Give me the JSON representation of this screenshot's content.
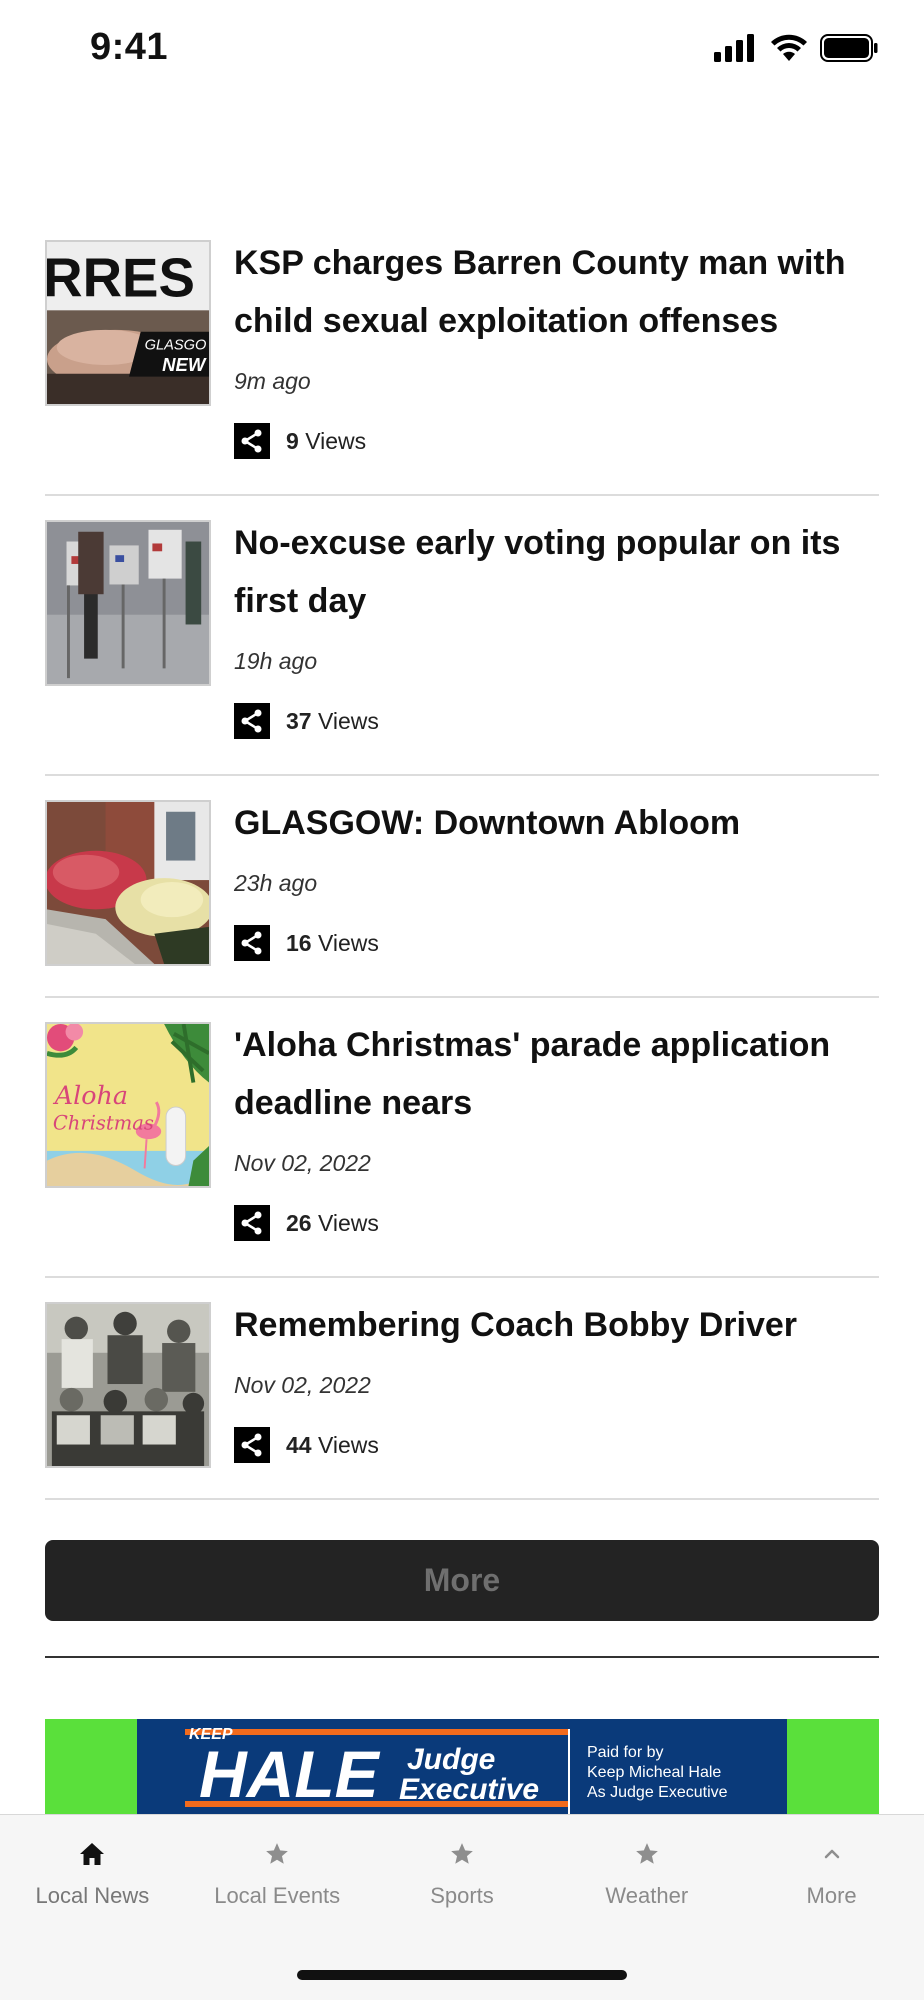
{
  "status_bar": {
    "time": "9:41",
    "icons": [
      "signal-icon",
      "wifi-icon",
      "battery-icon"
    ]
  },
  "articles": [
    {
      "title": "KSP charges Barren County man with child sexual exploitation offenses",
      "time": "9m ago",
      "views_count": "9",
      "views_label": "Views",
      "thumb_icon": "arrest-image",
      "thumb_text": [
        "RRES",
        "GLASGO",
        "NEW"
      ]
    },
    {
      "title": "No-excuse early voting popular on its first day",
      "time": "19h ago",
      "views_count": "37",
      "views_label": "Views",
      "thumb_icon": "voting-booths-image"
    },
    {
      "title": "GLASGOW: Downtown Abloom",
      "time": "23h ago",
      "views_count": "16",
      "views_label": "Views",
      "thumb_icon": "flowers-image"
    },
    {
      "title": "'Aloha Christmas' parade application deadline nears",
      "time": "Nov 02, 2022",
      "views_count": "26",
      "views_label": "Views",
      "thumb_icon": "aloha-christmas-image",
      "thumb_text": [
        "Aloha",
        "Christmas"
      ]
    },
    {
      "title": "Remembering Coach Bobby Driver",
      "time": "Nov 02, 2022",
      "views_count": "44",
      "views_label": "Views",
      "thumb_icon": "team-photo-image"
    }
  ],
  "more_button": "More",
  "ad": {
    "keep": "KEEP",
    "name": "HALE",
    "role_line1": "Judge",
    "role_line2": "Executive",
    "paid_line1": "Paid for by",
    "paid_line2": "Keep Micheal Hale",
    "paid_line3": "As Judge Executive",
    "bg_color": "#5ae03b",
    "panel_color": "#0a3a7a",
    "accent_color": "#f26b1d"
  },
  "tabs": [
    {
      "label": "Local News",
      "icon": "home-icon",
      "active": true
    },
    {
      "label": "Local Events",
      "icon": "star-icon",
      "active": false
    },
    {
      "label": "Sports",
      "icon": "star-icon",
      "active": false
    },
    {
      "label": "Weather",
      "icon": "star-icon",
      "active": false
    },
    {
      "label": "More",
      "icon": "chevron-up-icon",
      "active": false
    }
  ]
}
